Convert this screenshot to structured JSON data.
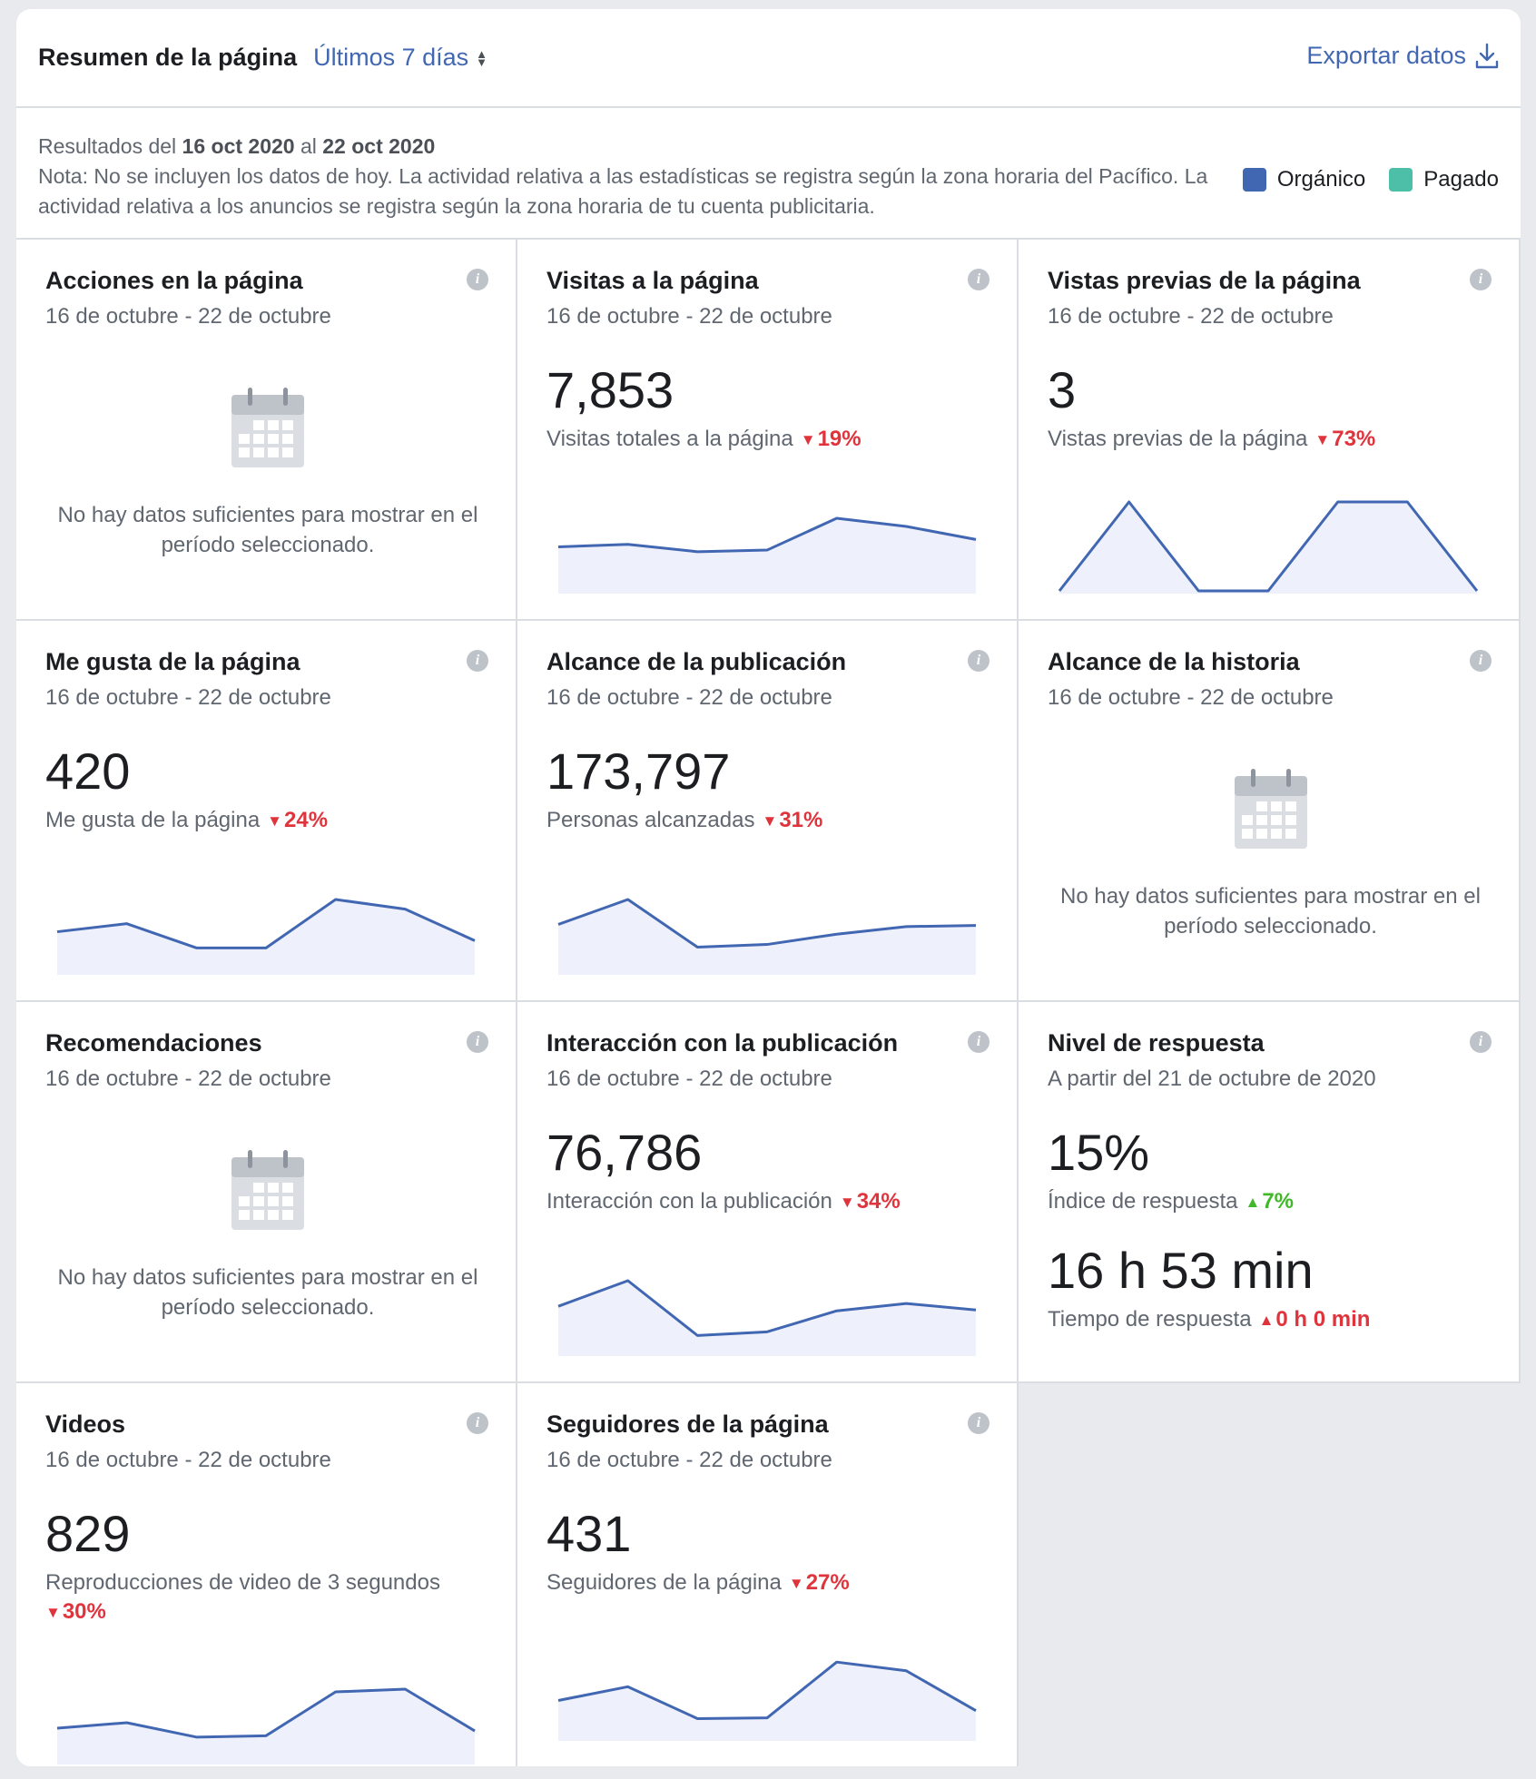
{
  "header": {
    "title": "Resumen de la página",
    "range_label": "Últimos 7 días",
    "export_label": "Exportar datos"
  },
  "notice": {
    "results_prefix": "Resultados del",
    "from": "16 oct 2020",
    "connector": "al",
    "to": "22 oct 2020",
    "note": "Nota: No se incluyen los datos de hoy. La actividad relativa a las estadísticas se registra según la zona horaria del Pacífico. La actividad relativa a los anuncios se registra según la zona horaria de tu cuenta publicitaria."
  },
  "legend": {
    "organic": {
      "label": "Orgánico",
      "color": "#4267b2"
    },
    "paid": {
      "label": "Pagado",
      "color": "#4dbfa8"
    }
  },
  "colors": {
    "line": "#4267b2",
    "fill": "#eef0fb",
    "down": "#e0343d",
    "up": "#42b72a"
  },
  "empty_text": "No hay datos suficientes para mostrar en el período seleccionado.",
  "cards": {
    "actions": {
      "title": "Acciones en la página",
      "date": "16 de octubre - 22 de octubre",
      "icon": "calendar-icon"
    },
    "visits": {
      "title": "Visitas a la página",
      "date": "16 de octubre - 22 de octubre",
      "value": "7,853",
      "label": "Visitas totales a la página",
      "change": "19%",
      "spark": [
        5.4,
        5.7,
        4.8,
        5.0,
        8.9,
        7.9,
        6.3
      ]
    },
    "previews": {
      "title": "Vistas previas de la página",
      "date": "16 de octubre - 22 de octubre",
      "value": "3",
      "label": "Vistas previas de la página",
      "change": "73%",
      "spark": [
        0,
        1,
        0,
        0,
        1,
        1,
        0
      ]
    },
    "likes": {
      "title": "Me gusta de la página",
      "date": "16 de octubre - 22 de octubre",
      "value": "420",
      "label": "Me gusta de la página",
      "change": "24%",
      "spark": [
        5.0,
        6.0,
        3.0,
        3.0,
        9.0,
        7.8,
        3.9
      ]
    },
    "post_reach": {
      "title": "Alcance de la publicación",
      "date": "16 de octubre - 22 de octubre",
      "value": "173,797",
      "label": "Personas alcanzadas",
      "change": "31%",
      "spark": [
        8.8,
        13.4,
        4.6,
        5.1,
        7.0,
        8.4,
        8.6
      ]
    },
    "story_reach": {
      "title": "Alcance de la historia",
      "date": "16 de octubre - 22 de octubre",
      "icon": "calendar-icon"
    },
    "recommendations": {
      "title": "Recomendaciones",
      "date": "16 de octubre - 22 de octubre",
      "icon": "calendar-icon"
    },
    "engagement": {
      "title": "Interacción con la publicación",
      "date": "16 de octubre - 22 de octubre",
      "value": "76,786",
      "label": "Interacción con la publicación",
      "change": "34%",
      "spark": [
        10.3,
        15.9,
        3.9,
        4.7,
        9.3,
        10.9,
        9.5
      ]
    },
    "response": {
      "title": "Nivel de respuesta",
      "date": "A partir del 21 de octubre de 2020",
      "rate_value": "15%",
      "rate_label": "Índice de respuesta",
      "rate_change": "7%",
      "time_value": "16 h 53 min",
      "time_label": "Tiempo de respuesta",
      "time_change": "0 h 0 min"
    },
    "videos": {
      "title": "Videos",
      "date": "16 de octubre - 22 de octubre",
      "value": "829",
      "label": "Reproducciones de video de 3 segundos",
      "change": "30%",
      "spark": [
        4.9,
        5.7,
        3.6,
        3.8,
        10.2,
        10.6,
        4.5
      ]
    },
    "followers": {
      "title": "Seguidores de la página",
      "date": "16 de octubre - 22 de octubre",
      "value": "431",
      "label": "Seguidores de la página",
      "change": "27%",
      "spark": [
        5.2,
        7.1,
        2.7,
        2.8,
        10.5,
        9.3,
        3.8
      ]
    }
  }
}
